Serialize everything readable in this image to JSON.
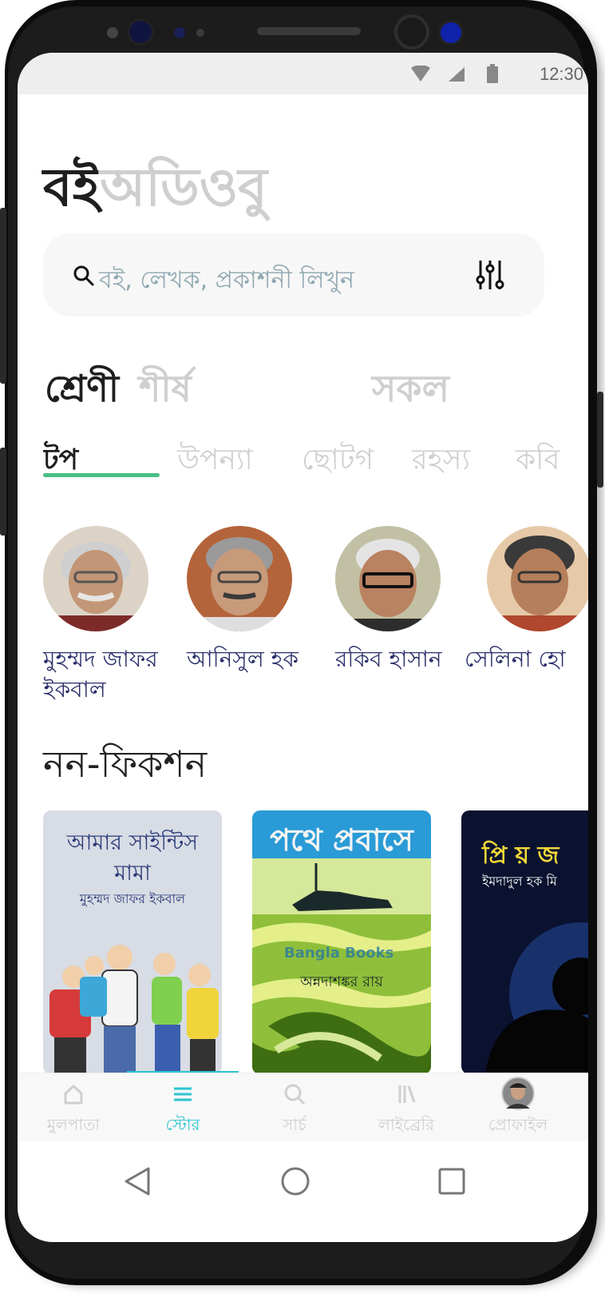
{
  "status_bar": {
    "time": "12:30"
  },
  "hero": {
    "title_main": "বই",
    "title_sub": "অডিওবু"
  },
  "search": {
    "placeholder": "বই, লেখক, প্রকাশনী লিখুন"
  },
  "category_tabs": {
    "active": "শ্রেণী",
    "inactive": "শীর্ষ",
    "all": "সকল"
  },
  "genres": [
    "টপ",
    "উপন্যা",
    "ছোটগ",
    "রহস্য",
    "কবি"
  ],
  "authors": [
    {
      "name": "মুহম্মদ জাফর ইকবাল"
    },
    {
      "name": "আনিসুল হক"
    },
    {
      "name": "রকিব হাসান"
    },
    {
      "name": "সেলিনা হো"
    }
  ],
  "section": {
    "title": "নন-ফিকশন"
  },
  "books": [
    {
      "title": "আমার সাইন্টিস মামা",
      "author": "মুহম্মদ জাফর ইকবাল"
    },
    {
      "title": "পথে প্রবাসে",
      "author": "অন্নদাশঙ্কর রায়",
      "watermark": "Bangla Books"
    },
    {
      "title": "প্রি য় জ",
      "author": "ইমদাদুল হক মি"
    }
  ],
  "bottom_nav": [
    {
      "label": "মুলপাতা",
      "icon": "home-icon"
    },
    {
      "label": "স্টোর",
      "icon": "menu-icon",
      "active": true
    },
    {
      "label": "সার্চ",
      "icon": "search-icon"
    },
    {
      "label": "লাইব্রেরি",
      "icon": "library-icon"
    },
    {
      "label": "প্রোফাইল",
      "icon": "avatar"
    }
  ],
  "colors": {
    "accent_green": "#48bf84",
    "accent_cyan": "#2bc5cf",
    "author_name": "#2a2f6a"
  }
}
